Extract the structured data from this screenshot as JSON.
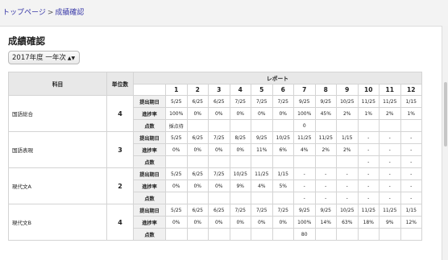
{
  "breadcrumb": {
    "home": "トップページ",
    "separator": ">",
    "current": "成績確認"
  },
  "page_title": "成績確認",
  "year_select": {
    "selected": "2017年度 一年次"
  },
  "table": {
    "col_subject": "科目",
    "col_units": "単位数",
    "col_report": "レポート",
    "report_numbers": [
      "1",
      "2",
      "3",
      "4",
      "5",
      "6",
      "7",
      "8",
      "9",
      "10",
      "11",
      "12"
    ],
    "row_labels": {
      "due": "提出期日",
      "progress": "進捗率",
      "score": "点数"
    },
    "subjects": [
      {
        "name": "国語総合",
        "units": "4",
        "due": [
          "5/25",
          "6/25",
          "6/25",
          "7/25",
          "7/25",
          "7/25",
          "9/25",
          "9/25",
          "10/25",
          "11/25",
          "11/25",
          "1/15"
        ],
        "progress": [
          "100%",
          "0%",
          "0%",
          "0%",
          "0%",
          "0%",
          "100%",
          "45%",
          "2%",
          "1%",
          "2%",
          "1%"
        ],
        "score": [
          "採点待",
          "",
          "",
          "",
          "",
          "",
          "0",
          "",
          "",
          "",
          "",
          ""
        ]
      },
      {
        "name": "国語表現",
        "units": "3",
        "due": [
          "5/25",
          "6/25",
          "7/25",
          "8/25",
          "9/25",
          "10/25",
          "11/25",
          "11/25",
          "1/15",
          "-",
          "-",
          "-"
        ],
        "progress": [
          "0%",
          "0%",
          "0%",
          "0%",
          "11%",
          "6%",
          "4%",
          "2%",
          "2%",
          "-",
          "-",
          "-"
        ],
        "score": [
          "",
          "",
          "",
          "",
          "",
          "",
          "",
          "",
          "",
          "-",
          "-",
          "-"
        ]
      },
      {
        "name": "現代文A",
        "units": "2",
        "due": [
          "5/25",
          "6/25",
          "7/25",
          "10/25",
          "11/25",
          "1/15",
          "-",
          "-",
          "-",
          "-",
          "-",
          "-"
        ],
        "progress": [
          "0%",
          "0%",
          "0%",
          "9%",
          "4%",
          "5%",
          "-",
          "-",
          "-",
          "-",
          "-",
          "-"
        ],
        "score": [
          "",
          "",
          "",
          "",
          "",
          "",
          "-",
          "-",
          "-",
          "-",
          "-",
          "-"
        ]
      },
      {
        "name": "現代文B",
        "units": "4",
        "due": [
          "5/25",
          "6/25",
          "6/25",
          "7/25",
          "7/25",
          "7/25",
          "9/25",
          "9/25",
          "10/25",
          "11/25",
          "11/25",
          "1/15"
        ],
        "progress": [
          "0%",
          "0%",
          "0%",
          "0%",
          "0%",
          "0%",
          "100%",
          "14%",
          "63%",
          "18%",
          "9%",
          "12%"
        ],
        "score": [
          "",
          "",
          "",
          "",
          "",
          "",
          "80",
          "",
          "",
          "",
          "",
          ""
        ]
      }
    ]
  }
}
